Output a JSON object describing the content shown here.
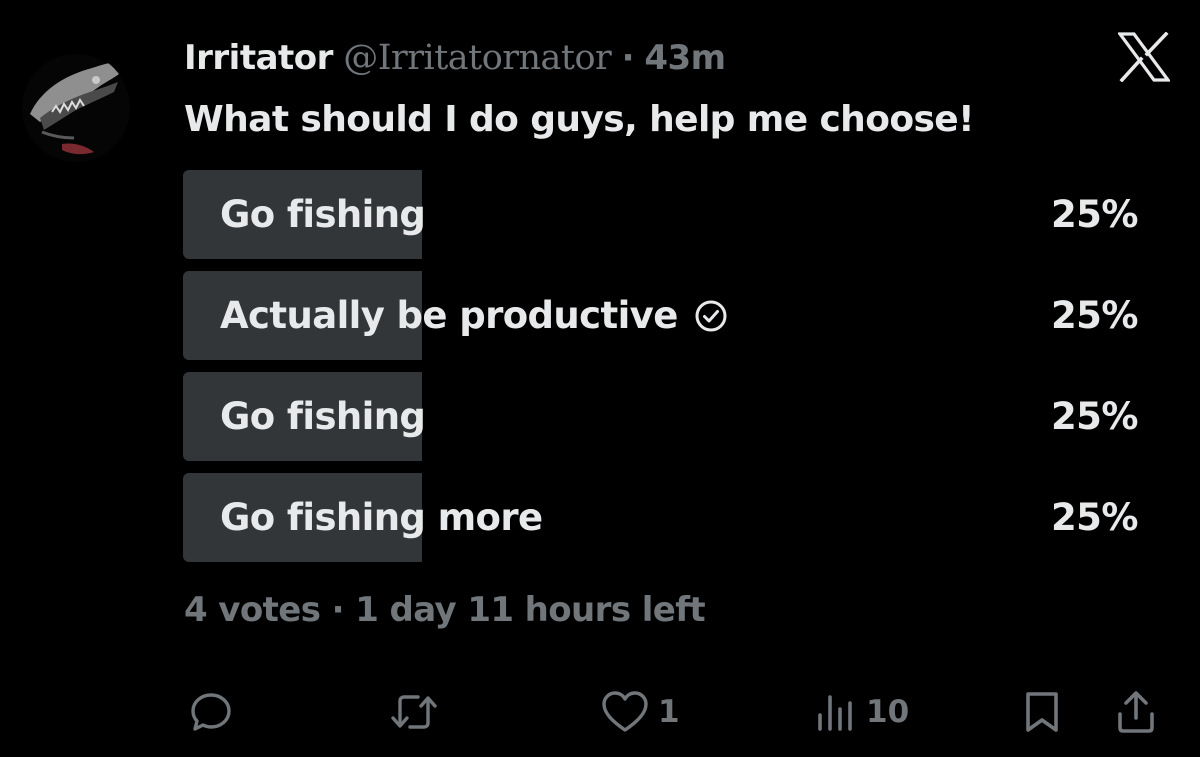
{
  "tweet": {
    "author_name": "Irritator",
    "handle": "@Irritatornator",
    "separator": "·",
    "time": "43m",
    "text": "What should I do guys, help me choose!"
  },
  "poll": {
    "options": [
      {
        "label": "Go fishing",
        "percent": "25%",
        "fraction": 0.25,
        "selected": false
      },
      {
        "label": "Actually be productive",
        "percent": "25%",
        "fraction": 0.25,
        "selected": true
      },
      {
        "label": "Go fishing",
        "percent": "25%",
        "fraction": 0.25,
        "selected": false
      },
      {
        "label": "Go fishing more",
        "percent": "25%",
        "fraction": 0.25,
        "selected": false
      }
    ],
    "votes": "4 votes",
    "separator": "·",
    "time_left": "1 day 11 hours left"
  },
  "actions": {
    "reply_count": "",
    "retweet_count": "",
    "like_count": "1",
    "views_count": "10"
  },
  "icons": {
    "brand": "x-logo-icon",
    "selected": "check-circle-icon",
    "reply": "reply-icon",
    "retweet": "retweet-icon",
    "like": "heart-icon",
    "views": "views-icon",
    "bookmark": "bookmark-icon",
    "share": "share-icon"
  },
  "colors": {
    "background": "#000000",
    "text": "#e7e9ea",
    "secondary": "#71767b",
    "poll_bar": "#333639"
  }
}
